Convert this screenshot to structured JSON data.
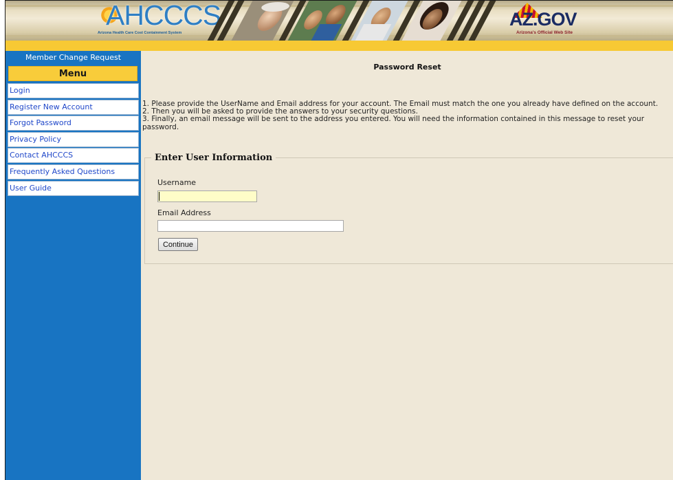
{
  "banner": {
    "ahcccs_logo_text": "AHCCCS",
    "ahcccs_tagline": "Arizona Health Care Cost Containment System",
    "azgov_logo_text": "AZ.GOV",
    "azgov_tagline": "Arizona's Official Web Site"
  },
  "sidebar": {
    "title": "Member Change Request",
    "menu_header": "Menu",
    "items": [
      {
        "label": "Login"
      },
      {
        "label": "Register New Account"
      },
      {
        "label": "Forgot Password"
      },
      {
        "label": "Privacy Policy"
      },
      {
        "label": "Contact AHCCCS"
      },
      {
        "label": "Frequently Asked Questions"
      },
      {
        "label": "User Guide"
      }
    ]
  },
  "main": {
    "title": "Password Reset",
    "instructions": [
      "1. Please provide the UserName and Email address for your account. The Email must match the one you already have defined on the account.",
      "2. Then you will be asked to provide the answers to your security questions.",
      "3. Finally, an email message will be sent to the address you entered. You will need the information contained in this message to reset your password."
    ],
    "form": {
      "legend": "Enter User Information",
      "username_label": "Username",
      "username_value": "",
      "email_label": "Email Address",
      "email_value": "",
      "continue_label": "Continue"
    }
  },
  "colors": {
    "sidebar_bg": "#1874c2",
    "menu_header_bg": "#f8cc3a",
    "gold_bar": "#f7c934",
    "content_bg": "#efe8d8",
    "link": "#1f47c9",
    "focused_input_bg": "#fffdc8"
  }
}
